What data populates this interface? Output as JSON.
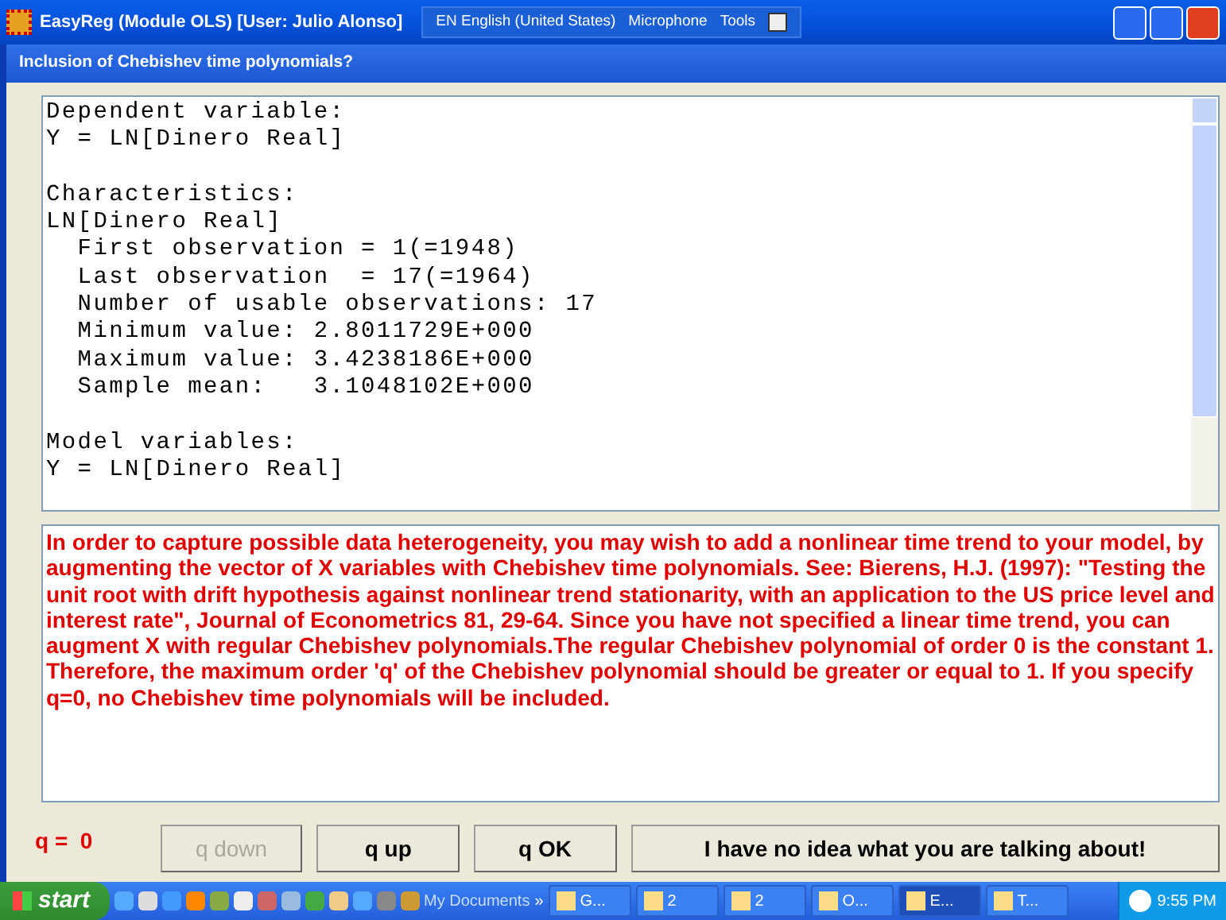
{
  "window": {
    "title": "EasyReg (Module OLS) [User: Julio Alonso]"
  },
  "language_bar": {
    "language": "EN English (United States)",
    "items": [
      "Microphone",
      "Tools"
    ]
  },
  "dialog": {
    "title": "Inclusion of Chebishev time polynomials?"
  },
  "output_blocks": [
    [
      "Dependent variable:",
      "Y = LN[Dinero Real]"
    ],
    [
      "Characteristics:",
      "LN[Dinero Real]",
      "  First observation = 1(=1948)",
      "  Last observation  = 17(=1964)",
      "  Number of usable observations: 17",
      "  Minimum value: 2.8011729E+000",
      "  Maximum value: 3.4238186E+000",
      "  Sample mean:   3.1048102E+000"
    ],
    [
      "Model variables:",
      "Y = LN[Dinero Real]"
    ]
  ],
  "message": "In order to capture possible data heterogeneity, you may wish to add a nonlinear time trend to your model, by augmenting the vector of X variables with Chebishev time polynomials. See: Bierens, H.J. (1997): \"Testing the unit root with drift hypothesis against nonlinear trend stationarity, with an application to the US price level and interest rate\", Journal of Econometrics 81, 29-64. Since you have not specified a linear time trend, you can augment X with regular Chebishev polynomials.The regular Chebishev polynomial of order 0 is the constant 1. Therefore, the maximum order 'q' of the Chebishev polynomial should be greater or equal to 1. If you specify q=0, no Chebishev time polynomials will be included.",
  "q_label": "q =  0",
  "buttons": [
    {
      "label": "q down",
      "disabled": true
    },
    {
      "label": "q up",
      "disabled": false
    },
    {
      "label": "q OK",
      "disabled": false
    },
    {
      "label": "I have no idea what you are talking about!",
      "disabled": false
    }
  ],
  "taskbar": {
    "start": "start",
    "toolbar": "My Documents",
    "chevron": "»",
    "tasks": [
      {
        "label": "G...",
        "selected": false
      },
      {
        "label": "2",
        "selected": false
      },
      {
        "label": "2",
        "selected": false
      },
      {
        "label": "O...",
        "selected": false
      },
      {
        "label": "E...",
        "selected": true
      },
      {
        "label": "T...",
        "selected": false
      }
    ],
    "clock": "9:55 PM"
  }
}
